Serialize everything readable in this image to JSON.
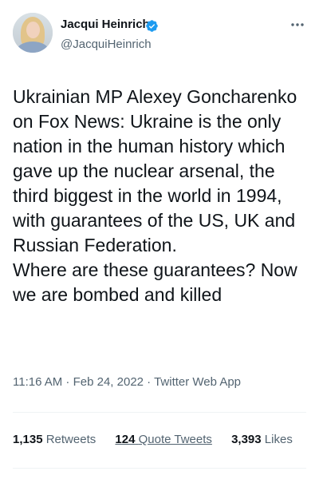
{
  "author": {
    "name": "Jacqui Heinrich",
    "handle": "@JacquiHeinrich",
    "verified": true,
    "badge_color": "#1d9bf0"
  },
  "tweet": {
    "paragraphs": [
      "Ukrainian MP Alexey Goncharenko on Fox News: Ukraine is the only nation in the human history which gave up the nuclear arsenal, the third biggest in the world in 1994, with guarantees of the US, UK and Russian Federation.",
      "Where are these guarantees? Now we are bombed and killed"
    ],
    "time": "11:16 AM",
    "date": "Feb 24, 2022",
    "source": "Twitter Web App",
    "separator": " · "
  },
  "stats": {
    "retweets_count": "1,135",
    "retweets_label": "Retweets",
    "quotes_count": "124",
    "quotes_label": "Quote Tweets",
    "likes_count": "3,393",
    "likes_label": "Likes"
  },
  "icons": {
    "more": "more-options-icon",
    "verified": "verified-badge-icon"
  }
}
